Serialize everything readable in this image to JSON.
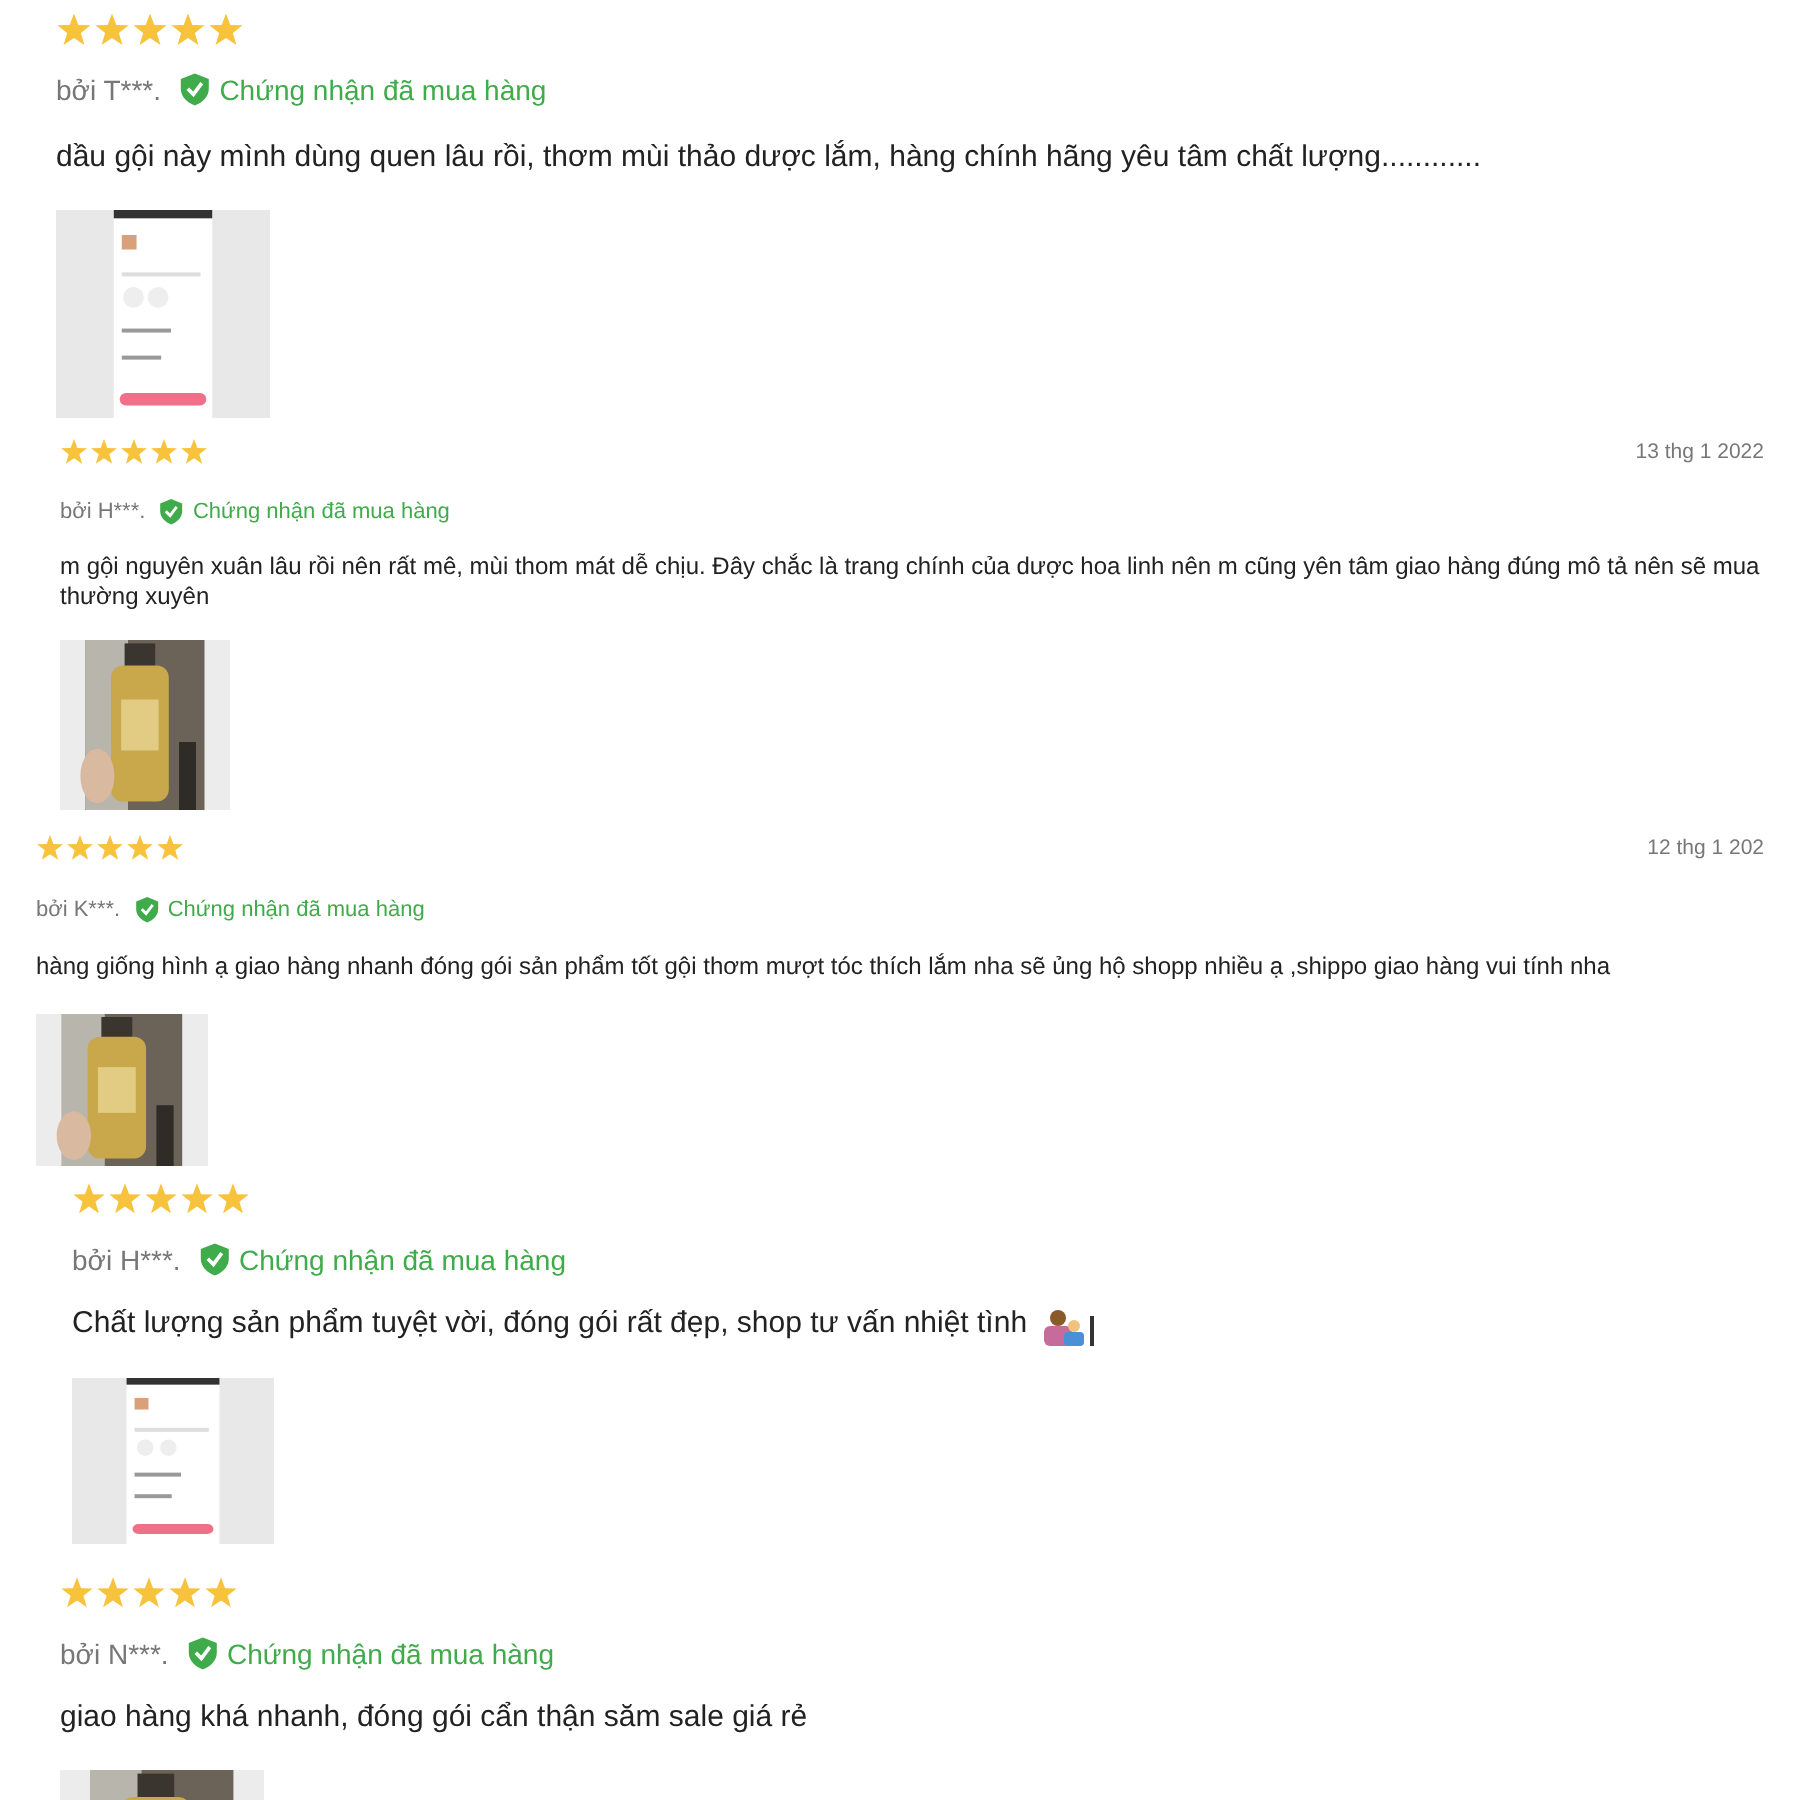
{
  "reviews": [
    {
      "stars": 5,
      "author": "bởi T***.",
      "badge": "Chứng nhận đã mua hàng",
      "text": "dầu gội này mình dùng quen lâu rồi, thơm mùi thảo dược lắm, hàng chính hãng yêu tâm chất lượng............",
      "photo": {
        "kind": "screenshot"
      }
    },
    {
      "stars": 5,
      "date": "13 thg 1 2022",
      "author": "bởi H***.",
      "badge": "Chứng nhận đã mua hàng",
      "text": "m gội nguyên xuân lâu rồi nên rất mê, mùi thom mát dễ chịu. Đây chắc là trang chính của dược hoa linh nên m cũng yên tâm  giao hàng đúng mô tả nên sẽ mua thường xuyên",
      "photo": {
        "kind": "bottle"
      }
    },
    {
      "stars": 5,
      "date": "12 thg 1 202",
      "author": "bởi K***.",
      "badge": "Chứng nhận đã mua hàng",
      "text": "hàng giống hình ạ giao hàng nhanh đóng gói sản phẩm tốt gội thơm mượt tóc thích lắm nha sẽ ủng hộ shopp nhiều ạ ,shippo giao hàng vui tính nha",
      "photo": {
        "kind": "bottle"
      }
    },
    {
      "stars": 5,
      "author": "bởi H***.",
      "badge": "Chứng nhận đã mua hàng",
      "text": "Chất lượng sản phẩm tuyệt vời, đóng gói rất đẹp, shop tư vấn nhiệt tình",
      "emoji": true,
      "photo": {
        "kind": "screenshot"
      }
    },
    {
      "stars": 5,
      "author": "bởi N***.",
      "badge": "Chứng nhận đã mua hàng",
      "text": "giao hàng khá nhanh, đóng gói cẩn thận săm sale giá rẻ",
      "photo": {
        "kind": "bottle"
      }
    }
  ]
}
